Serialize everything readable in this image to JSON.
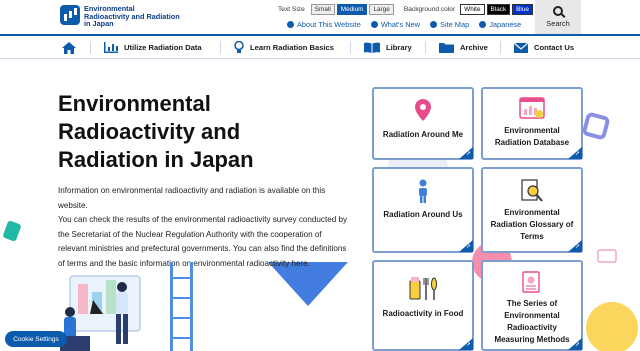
{
  "header": {
    "logo_line1": "Environmental",
    "logo_line2": "Radioactivity and Radiation",
    "logo_line3": "in Japan",
    "text_size_label": "Text Size",
    "sizes": [
      "Small",
      "Medium",
      "Large"
    ],
    "active_size": "Medium",
    "bg_color_label": "Background color",
    "bg_options": [
      "White",
      "Black",
      "Blue"
    ],
    "links": [
      "About This Website",
      "What's New",
      "Site Map",
      "Japanese"
    ],
    "search_label": "Search"
  },
  "nav": {
    "items": [
      "Utilize Radiation Data",
      "Learn Radiation Basics",
      "Library",
      "Archive",
      "Contact Us"
    ]
  },
  "hero": {
    "title_line1": "Environmental",
    "title_line2": "Radioactivity and",
    "title_line3": "Radiation in Japan",
    "desc_p1": "Information on environmental radioactivity and radiation is available on this website.",
    "desc_p2": "You can check the results of the environmental radioactivity survey conducted by the Secretariat of the Nuclear Regulation Authority with the cooperation of relevant ministries and prefectural governments. You can also find the definitions of terms and the basic information on environmental radioactivity here."
  },
  "cards": [
    {
      "title": "Radiation Around Me",
      "icon": "location-pin-icon"
    },
    {
      "title": "Environmental Radiation Database",
      "icon": "database-chart-icon"
    },
    {
      "title": "Radiation Around Us",
      "icon": "person-icon"
    },
    {
      "title": "Environmental Radiation Glossary of Terms",
      "icon": "glossary-search-icon"
    },
    {
      "title": "Radioactivity in Food",
      "icon": "food-icon"
    },
    {
      "title": "The Series of Environmental Radioactivity Measuring Methods",
      "icon": "document-icon"
    }
  ],
  "cookie": {
    "label": "Cookie Settings"
  },
  "colors": {
    "brand": "#0d5bab",
    "card_border": "#7d9ed1"
  }
}
